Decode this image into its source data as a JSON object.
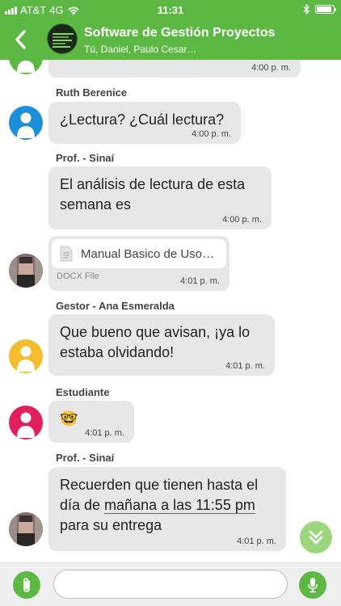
{
  "status_bar": {
    "carrier": "AT&T",
    "network": "4G",
    "time": "11:31"
  },
  "header": {
    "title": "Software de Gestión Proyectos",
    "subtitle": "Tú, Daniel, Paulo Cesar…"
  },
  "messages": [
    {
      "sender": "",
      "text": "",
      "time": "4:00 p. m."
    },
    {
      "sender": "Ruth Berenice",
      "text": "¿Lectura? ¿Cuál lectura?",
      "time": "4:00 p. m."
    },
    {
      "sender": "Prof. - Sinaí",
      "text": "El análisis de lectura de esta semana es",
      "time": "4:00 p. m."
    },
    {
      "sender": "",
      "file_name": "Manual Basico de Uso…",
      "file_type": "DOCX File",
      "time": "4:01 p. m."
    },
    {
      "sender": "Gestor - Ana Esmeralda",
      "text": "Que bueno que avisan, ¡ya lo estaba olvidando!",
      "time": "4:01 p. m."
    },
    {
      "sender": "Estudiante",
      "text": "🤓",
      "time": "4:01 p. m."
    },
    {
      "sender": "Prof. - Sinaí",
      "text_before": "Recuerden que tienen hasta el día de ",
      "text_link": "mañana a las 11:55 pm",
      "text_after": " para su entrega",
      "time": "4:01 p. m."
    }
  ],
  "input": {
    "placeholder": ""
  },
  "colors": {
    "brand_green": "#5cb843",
    "bubble_gray": "#e7e7e7",
    "avatar_blue": "#1d8fd6",
    "avatar_yellow": "#f4bd2e",
    "avatar_pink": "#e01f5c"
  }
}
